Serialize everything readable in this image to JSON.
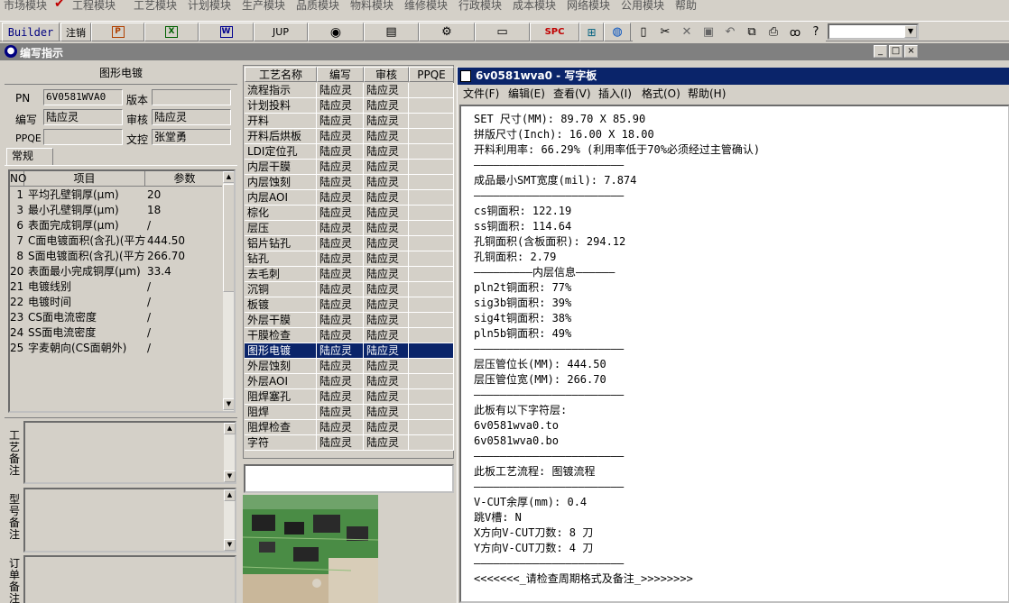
{
  "top_menu": {
    "items": [
      "市场模块",
      "工程模块",
      "工艺模块",
      "计划模块",
      "生产模块",
      "品质模块",
      "物料模块",
      "维修模块",
      "行政模块",
      "成本模块",
      "网络模块",
      "公用模块",
      "帮助"
    ]
  },
  "toolbar": {
    "builder_label": "Builder",
    "logout_label": "注销",
    "jup_label": "JUP",
    "spc_label": "SPC",
    "combo_value": ""
  },
  "window": {
    "title": "编写指示"
  },
  "left": {
    "section_title": "图形电镀",
    "pn_label": "PN",
    "pn_value": "6V0581WVA0",
    "version_label": "版本",
    "version_value": "",
    "author_label": "编写",
    "author_value": "陆应灵",
    "reviewer_label": "审核",
    "reviewer_value": "陆应灵",
    "ppqe_label": "PPQE",
    "ppqe_value": "",
    "doc_control_label": "文控",
    "doc_control_value": "张堂勇",
    "tab_label": "常规",
    "grid_headers": [
      "NO",
      "项目",
      "参数"
    ],
    "params": [
      {
        "no": "1",
        "item": "平均孔壁铜厚(μm)",
        "value": "20"
      },
      {
        "no": "3",
        "item": "最小孔壁铜厚(μm)",
        "value": "18"
      },
      {
        "no": "6",
        "item": "表面完成铜厚(μm)",
        "value": "/"
      },
      {
        "no": "7",
        "item": "C面电镀面积(含孔)(平方",
        "value": "444.50"
      },
      {
        "no": "8",
        "item": "S面电镀面积(含孔)(平方",
        "value": "266.70"
      },
      {
        "no": "20",
        "item": "表面最小完成铜厚(μm)",
        "value": "33.4"
      },
      {
        "no": "21",
        "item": "电镀线别",
        "value": "/"
      },
      {
        "no": "22",
        "item": "电镀时间",
        "value": "/"
      },
      {
        "no": "23",
        "item": "CS面电流密度",
        "value": "/"
      },
      {
        "no": "24",
        "item": "SS面电流密度",
        "value": "/"
      },
      {
        "no": "25",
        "item": "字麦朝向(CS面朝外)",
        "value": "/"
      }
    ],
    "memo_labels": [
      "工艺备注",
      "型号备注",
      "订单备注"
    ]
  },
  "process": {
    "headers": [
      "工艺名称",
      "编写",
      "审核",
      "PPQE"
    ],
    "selected_index": 17,
    "rows": [
      {
        "name": "流程指示",
        "author": "陆应灵",
        "reviewer": "陆应灵",
        "ppqe": ""
      },
      {
        "name": "计划投料",
        "author": "陆应灵",
        "reviewer": "陆应灵",
        "ppqe": ""
      },
      {
        "name": "开料",
        "author": "陆应灵",
        "reviewer": "陆应灵",
        "ppqe": ""
      },
      {
        "name": "开料后烘板",
        "author": "陆应灵",
        "reviewer": "陆应灵",
        "ppqe": ""
      },
      {
        "name": "LDI定位孔",
        "author": "陆应灵",
        "reviewer": "陆应灵",
        "ppqe": ""
      },
      {
        "name": "内层干膜",
        "author": "陆应灵",
        "reviewer": "陆应灵",
        "ppqe": ""
      },
      {
        "name": "内层蚀刻",
        "author": "陆应灵",
        "reviewer": "陆应灵",
        "ppqe": ""
      },
      {
        "name": "内层AOI",
        "author": "陆应灵",
        "reviewer": "陆应灵",
        "ppqe": ""
      },
      {
        "name": "棕化",
        "author": "陆应灵",
        "reviewer": "陆应灵",
        "ppqe": ""
      },
      {
        "name": "层压",
        "author": "陆应灵",
        "reviewer": "陆应灵",
        "ppqe": ""
      },
      {
        "name": "铝片钻孔",
        "author": "陆应灵",
        "reviewer": "陆应灵",
        "ppqe": ""
      },
      {
        "name": "钻孔",
        "author": "陆应灵",
        "reviewer": "陆应灵",
        "ppqe": ""
      },
      {
        "name": "去毛刺",
        "author": "陆应灵",
        "reviewer": "陆应灵",
        "ppqe": ""
      },
      {
        "name": "沉铜",
        "author": "陆应灵",
        "reviewer": "陆应灵",
        "ppqe": ""
      },
      {
        "name": "板镀",
        "author": "陆应灵",
        "reviewer": "陆应灵",
        "ppqe": ""
      },
      {
        "name": "外层干膜",
        "author": "陆应灵",
        "reviewer": "陆应灵",
        "ppqe": ""
      },
      {
        "name": "干膜检查",
        "author": "陆应灵",
        "reviewer": "陆应灵",
        "ppqe": ""
      },
      {
        "name": "图形电镀",
        "author": "陆应灵",
        "reviewer": "陆应灵",
        "ppqe": ""
      },
      {
        "name": "外层蚀刻",
        "author": "陆应灵",
        "reviewer": "陆应灵",
        "ppqe": ""
      },
      {
        "name": "外层AOI",
        "author": "陆应灵",
        "reviewer": "陆应灵",
        "ppqe": ""
      },
      {
        "name": "阻焊塞孔",
        "author": "陆应灵",
        "reviewer": "陆应灵",
        "ppqe": ""
      },
      {
        "name": "阻焊",
        "author": "陆应灵",
        "reviewer": "陆应灵",
        "ppqe": ""
      },
      {
        "name": "阻焊检查",
        "author": "陆应灵",
        "reviewer": "陆应灵",
        "ppqe": ""
      },
      {
        "name": "字符",
        "author": "陆应灵",
        "reviewer": "陆应灵",
        "ppqe": ""
      }
    ]
  },
  "notepad": {
    "title": "6v0581wva0 - 写字板",
    "menu": [
      "文件(F)",
      "编辑(E)",
      "查看(V)",
      "插入(I)",
      "格式(O)",
      "帮助(H)"
    ],
    "lines": [
      "SET 尺寸(MM): 89.70 X 85.90",
      "拼版尺寸(Inch): 16.00 X 18.00",
      "开料利用率: 66.29% (利用率低于70%必须经过主管确认)",
      "———————————————————————",
      "成品最小SMT宽度(mil): 7.874",
      "———————————————————————",
      "cs铜面积: 122.19",
      "ss铜面积: 114.64",
      "孔铜面积(含板面积): 294.12",
      "孔铜面积: 2.79",
      "—————————内层信息——————",
      "pln2t铜面积: 77%",
      "sig3b铜面积: 39%",
      "sig4t铜面积: 38%",
      "pln5b铜面积: 49%",
      "———————————————————————",
      "层压管位长(MM): 444.50",
      "层压管位宽(MM): 266.70",
      "———————————————————————",
      "此板有以下字符层:",
      "6v0581wva0.to",
      "6v0581wva0.bo",
      "———————————————————————",
      "此板工艺流程: 图镀流程",
      "———————————————————————",
      "V-CUT余厚(mm): 0.4",
      "跳V槽: N",
      "X方向V-CUT刀数: 8 刀",
      "Y方向V-CUT刀数: 4 刀",
      "———————————————————————",
      "<<<<<<<_请检查周期格式及备注_>>>>>>>>"
    ]
  }
}
